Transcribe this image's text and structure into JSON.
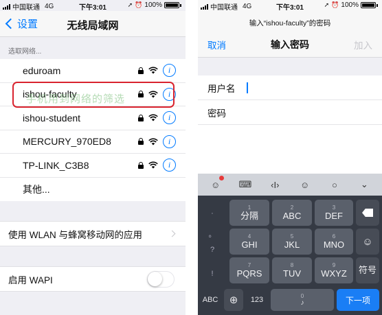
{
  "left": {
    "status": {
      "carrier": "中国联通",
      "network": "4G",
      "time": "下午3:01",
      "battery": "100%"
    },
    "navbar": {
      "back_label": "设置",
      "title": "无线局域网"
    },
    "section_header": "选取网络...",
    "networks": [
      {
        "name": "eduroam"
      },
      {
        "name": "ishou-faculty"
      },
      {
        "name": "ishou-student"
      },
      {
        "name": "MERCURY_970ED8"
      },
      {
        "name": "TP-LINK_C3B8"
      },
      {
        "name": "其他..."
      }
    ],
    "watermark": "手机用到网络的筛选",
    "wlan_apps_label": "使用 WLAN 与蜂窝移动网的应用",
    "wapi_label": "启用 WAPI"
  },
  "right": {
    "status": {
      "carrier": "中国联通",
      "network": "4G",
      "time": "下午3:01",
      "battery": "100%"
    },
    "prompt": "输入“ishou-faculty”的密码",
    "navbar": {
      "cancel_label": "取消",
      "title": "输入密码",
      "join_label": "加入"
    },
    "form": {
      "username_label": "用户名",
      "password_label": "密码"
    },
    "keyboard": {
      "side_keys": [
        "·",
        "。",
        "?",
        "!"
      ],
      "row1": [
        {
          "num": "1",
          "label": "分隔"
        },
        {
          "num": "2",
          "label": "ABC"
        },
        {
          "num": "3",
          "label": "DEF"
        }
      ],
      "row2": [
        {
          "num": "4",
          "label": "GHI"
        },
        {
          "num": "5",
          "label": "JKL"
        },
        {
          "num": "6",
          "label": "MNO"
        }
      ],
      "row3": [
        {
          "num": "7",
          "label": "PQRS"
        },
        {
          "num": "8",
          "label": "TUV"
        },
        {
          "num": "9",
          "label": "WXYZ"
        }
      ],
      "symbol_key": "符号",
      "bottom": {
        "abc": "ABC",
        "num": "123",
        "space_num": "0",
        "next": "下一项"
      }
    }
  }
}
